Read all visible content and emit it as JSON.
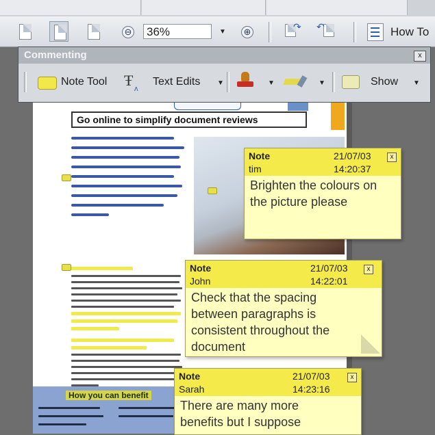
{
  "toolbar": {
    "zoom_value": "36%",
    "zoom_out_symbol": "⊖",
    "zoom_in_symbol": "⊕",
    "how_to_label": "How To"
  },
  "commenting": {
    "title": "Commenting",
    "close_symbol": "x",
    "note_tool_label": "Note Tool",
    "text_edits_label": "Text Edits",
    "show_label": "Show"
  },
  "document": {
    "heading": "Go online to simplify document reviews",
    "benefits_title": "How you can benefit"
  },
  "notes": [
    {
      "type": "Note",
      "author": "tim",
      "date": "21/07/03",
      "time": "14:20:37",
      "text": "Brighten the colours on the picture please",
      "close": "x"
    },
    {
      "type": "Note",
      "author": "John",
      "date": "21/07/03",
      "time": "14:22:01",
      "text": "Check that the spacing between paragraphs is consistent throughout the document",
      "close": "x"
    },
    {
      "type": "Note",
      "author": "Sarah",
      "date": "21/07/03",
      "time": "14:23:16",
      "text": "There are many more benefits but I suppose",
      "close": "x"
    }
  ],
  "colors": {
    "note_header": "#f4ea4a",
    "note_body": "#ffffc0",
    "panel_bg": "#d7dade"
  }
}
